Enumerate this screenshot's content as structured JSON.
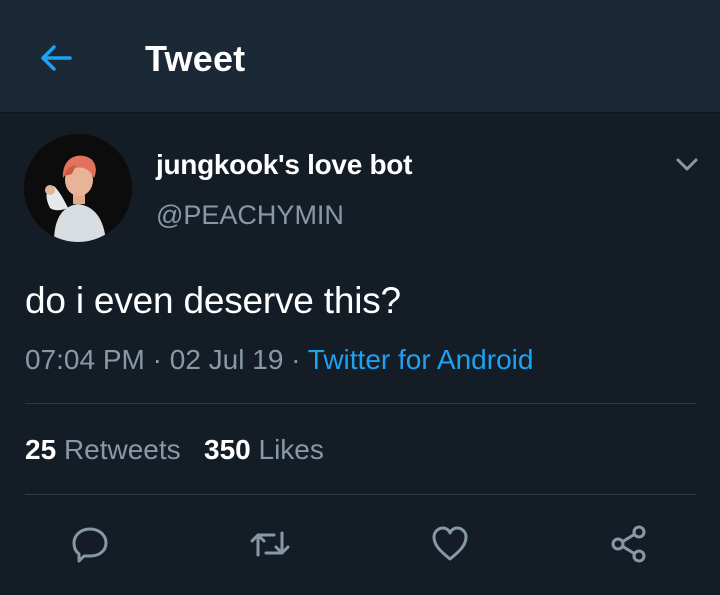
{
  "header": {
    "title": "Tweet",
    "back_icon": "back-arrow-icon"
  },
  "tweet": {
    "display_name": "jungkook's love bot",
    "handle": "@PEACHYMIN",
    "text": "do i even deserve this?",
    "time": "07:04 PM",
    "separator": "·",
    "date": "02 Jul 19",
    "source": "Twitter for Android"
  },
  "stats": {
    "retweets_count": "25",
    "retweets_label": "Retweets",
    "likes_count": "350",
    "likes_label": "Likes"
  },
  "actions": [
    "reply-icon",
    "retweet-icon",
    "like-icon",
    "share-icon"
  ],
  "colors": {
    "background": "#141d26",
    "header_bg": "#1b2836",
    "accent": "#1da1f2",
    "secondary_text": "#8899a6",
    "divider": "#2b3a48"
  }
}
